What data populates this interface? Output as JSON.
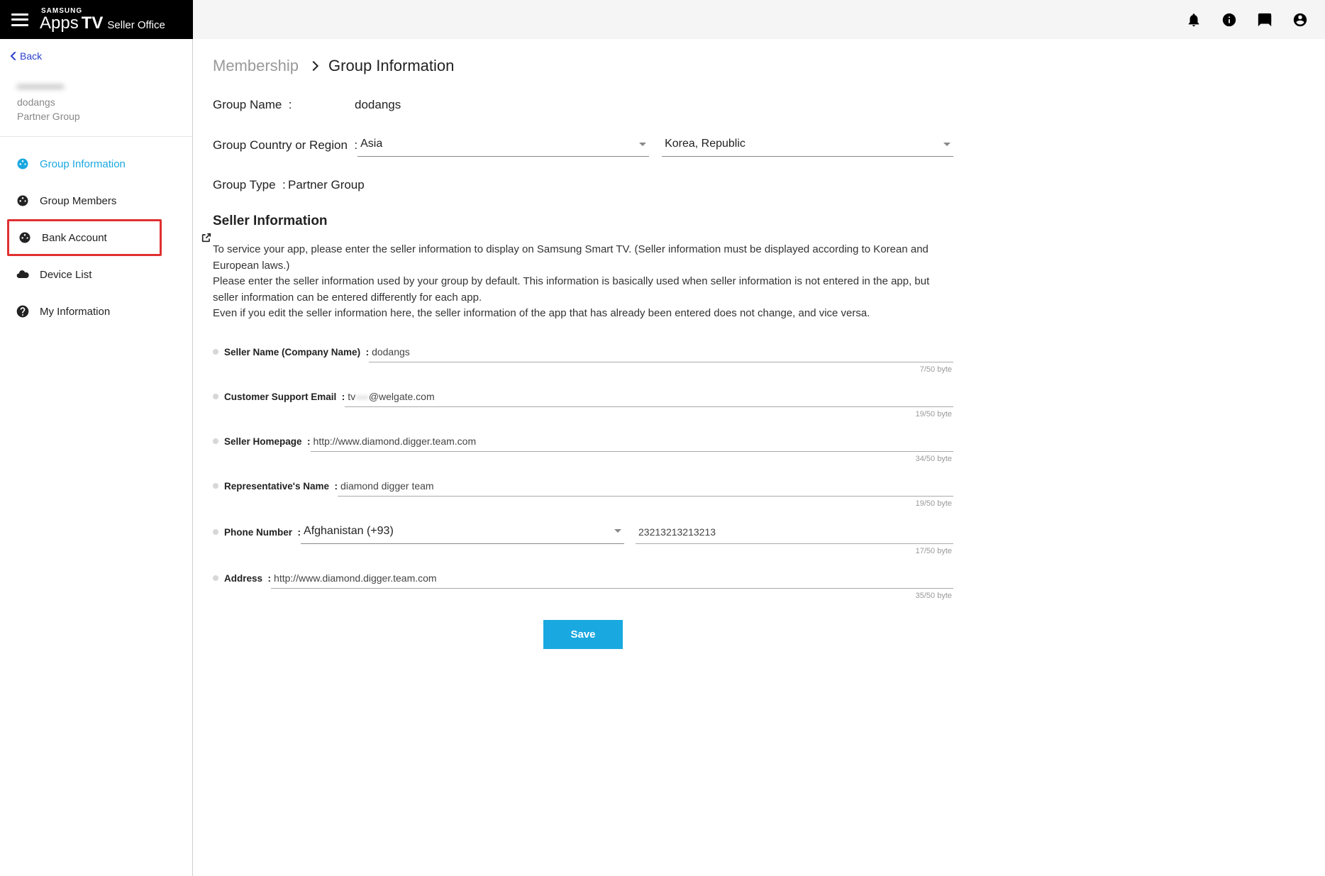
{
  "brand": {
    "top": "SAMSUNG",
    "apps": "Apps",
    "tv": "TV",
    "so": "Seller Office"
  },
  "back_label": "Back",
  "user": {
    "name": "-----------",
    "group": "dodangs",
    "type": "Partner Group"
  },
  "nav": {
    "group_info": "Group Information",
    "group_members": "Group Members",
    "bank_account": "Bank Account",
    "device_list": "Device List",
    "my_info": "My Information"
  },
  "breadcrumb": {
    "parent": "Membership",
    "current": "Group Information"
  },
  "group": {
    "name_label": "Group Name",
    "name_value": "dodangs",
    "country_label": "Group Country or Region",
    "region_value": "Asia",
    "country_value": "Korea, Republic",
    "type_label": "Group Type",
    "type_value": "Partner Group"
  },
  "seller": {
    "section_title": "Seller Information",
    "desc_1": "To service your app, please enter the seller information to display on Samsung Smart TV. (Seller information must be displayed according to Korean and European laws.)",
    "desc_2": "Please enter the seller information used by your group by default. This information is basically used when seller information is not entered in the app, but seller information can be entered differently for each app.",
    "desc_3": "Even if you edit the seller information here, the seller information of the app that has already been entered does not change, and vice versa.",
    "name_label": "Seller Name (Company Name)",
    "name_value": "dodangs",
    "name_bytes": "7/50 byte",
    "email_label": "Customer Support Email",
    "email_prefix": "tv",
    "email_blurred": "----",
    "email_suffix": "@welgate.com",
    "email_bytes": "19/50 byte",
    "homepage_label": "Seller Homepage",
    "homepage_value": "http://www.diamond.digger.team.com",
    "homepage_bytes": "34/50 byte",
    "rep_label": "Representative's Name",
    "rep_value": "diamond digger team",
    "rep_bytes": "19/50 byte",
    "phone_label": "Phone Number",
    "phone_country": "Afghanistan (+93)",
    "phone_value": "23213213213213",
    "phone_bytes": "17/50 byte",
    "address_label": "Address",
    "address_value": "http://www.diamond.digger.team.com",
    "address_bytes": "35/50 byte"
  },
  "save_label": "Save"
}
